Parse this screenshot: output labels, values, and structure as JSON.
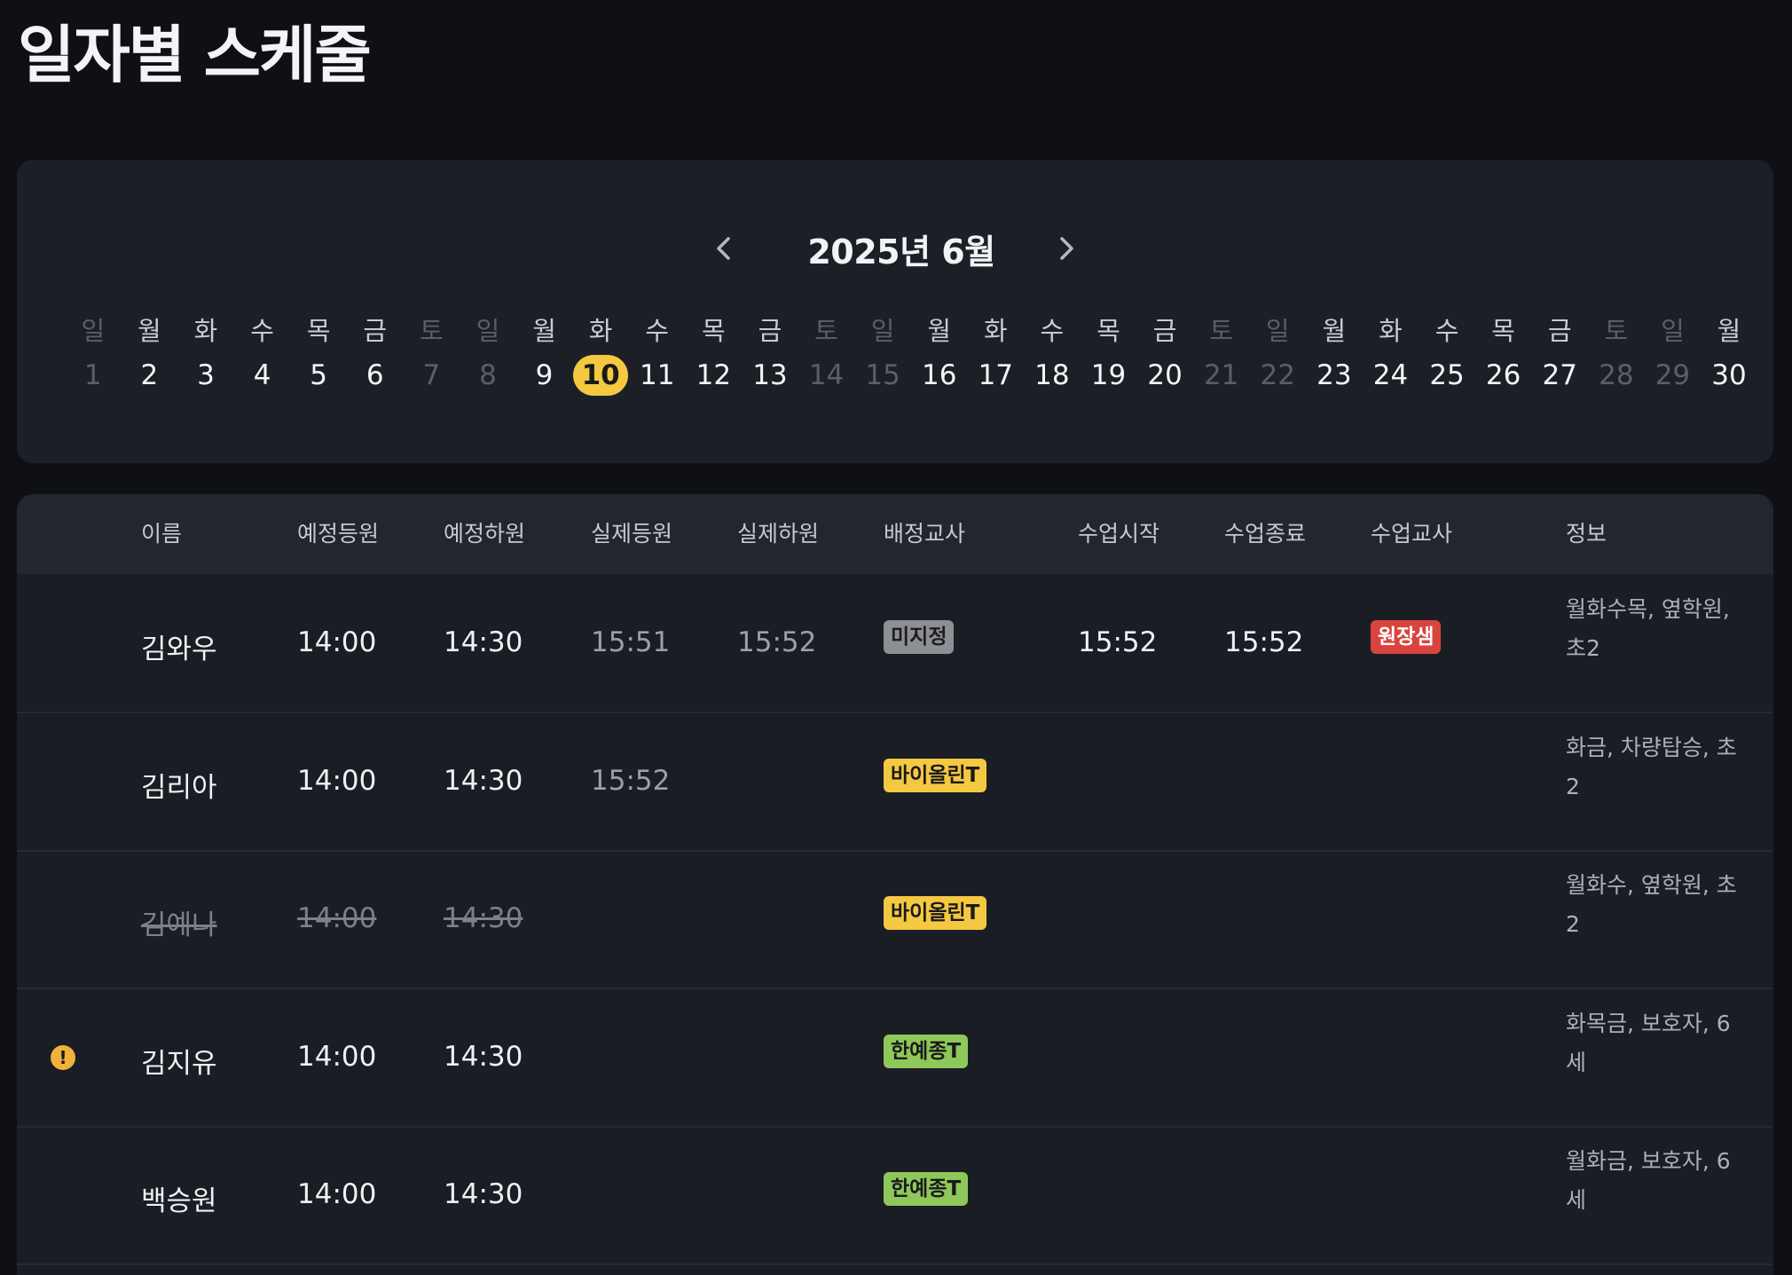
{
  "page": {
    "title": "일자별 스케줄"
  },
  "calendar": {
    "month_label": "2025년 6월",
    "selected_day": "10",
    "days": [
      {
        "dow": "일",
        "num": "1",
        "weekend": true
      },
      {
        "dow": "월",
        "num": "2",
        "weekend": false
      },
      {
        "dow": "화",
        "num": "3",
        "weekend": false
      },
      {
        "dow": "수",
        "num": "4",
        "weekend": false
      },
      {
        "dow": "목",
        "num": "5",
        "weekend": false
      },
      {
        "dow": "금",
        "num": "6",
        "weekend": false
      },
      {
        "dow": "토",
        "num": "7",
        "weekend": true
      },
      {
        "dow": "일",
        "num": "8",
        "weekend": true
      },
      {
        "dow": "월",
        "num": "9",
        "weekend": false
      },
      {
        "dow": "화",
        "num": "10",
        "weekend": false
      },
      {
        "dow": "수",
        "num": "11",
        "weekend": false
      },
      {
        "dow": "목",
        "num": "12",
        "weekend": false
      },
      {
        "dow": "금",
        "num": "13",
        "weekend": false
      },
      {
        "dow": "토",
        "num": "14",
        "weekend": true
      },
      {
        "dow": "일",
        "num": "15",
        "weekend": true
      },
      {
        "dow": "월",
        "num": "16",
        "weekend": false
      },
      {
        "dow": "화",
        "num": "17",
        "weekend": false
      },
      {
        "dow": "수",
        "num": "18",
        "weekend": false
      },
      {
        "dow": "목",
        "num": "19",
        "weekend": false
      },
      {
        "dow": "금",
        "num": "20",
        "weekend": false
      },
      {
        "dow": "토",
        "num": "21",
        "weekend": true
      },
      {
        "dow": "일",
        "num": "22",
        "weekend": true
      },
      {
        "dow": "월",
        "num": "23",
        "weekend": false
      },
      {
        "dow": "화",
        "num": "24",
        "weekend": false
      },
      {
        "dow": "수",
        "num": "25",
        "weekend": false
      },
      {
        "dow": "목",
        "num": "26",
        "weekend": false
      },
      {
        "dow": "금",
        "num": "27",
        "weekend": false
      },
      {
        "dow": "토",
        "num": "28",
        "weekend": true
      },
      {
        "dow": "일",
        "num": "29",
        "weekend": true
      },
      {
        "dow": "월",
        "num": "30",
        "weekend": false
      }
    ]
  },
  "table": {
    "headers": {
      "name": "이름",
      "planned_in": "예정등원",
      "planned_out": "예정하원",
      "actual_in": "실제등원",
      "actual_out": "실제하원",
      "assigned_teacher": "배정교사",
      "class_start": "수업시작",
      "class_end": "수업종료",
      "class_teacher": "수업교사",
      "info": "정보"
    },
    "rows": [
      {
        "warning": false,
        "cancelled": false,
        "name": "김와우",
        "planned_in": "14:00",
        "planned_out": "14:30",
        "actual_in": "15:51",
        "actual_out": "15:52",
        "assigned_teacher": "미지정",
        "assigned_color": "#8d8f94",
        "class_start": "15:52",
        "class_end": "15:52",
        "class_teacher": "원장샘",
        "class_teacher_color": "#d9453e",
        "info": "월화수목, 옆학원, 초2"
      },
      {
        "warning": false,
        "cancelled": false,
        "name": "김리아",
        "planned_in": "14:00",
        "planned_out": "14:30",
        "actual_in": "15:52",
        "actual_out": "",
        "assigned_teacher": "바이올린T",
        "assigned_color": "#f5c842",
        "class_start": "",
        "class_end": "",
        "class_teacher": "",
        "info": "화금, 차량탑승, 초2"
      },
      {
        "warning": false,
        "cancelled": true,
        "name": "김예나",
        "planned_in": "14:00",
        "planned_out": "14:30",
        "actual_in": "",
        "actual_out": "",
        "assigned_teacher": "바이올린T",
        "assigned_color": "#f5c842",
        "class_start": "",
        "class_end": "",
        "class_teacher": "",
        "info": "월화수, 옆학원, 초2"
      },
      {
        "warning": true,
        "cancelled": false,
        "name": "김지유",
        "planned_in": "14:00",
        "planned_out": "14:30",
        "actual_in": "",
        "actual_out": "",
        "assigned_teacher": "한예종T",
        "assigned_color": "#8fc85a",
        "class_start": "",
        "class_end": "",
        "class_teacher": "",
        "info": "화목금, 보호자, 6세"
      },
      {
        "warning": false,
        "cancelled": false,
        "name": "백승원",
        "planned_in": "14:00",
        "planned_out": "14:30",
        "actual_in": "",
        "actual_out": "",
        "assigned_teacher": "한예종T",
        "assigned_color": "#8fc85a",
        "class_start": "",
        "class_end": "",
        "class_teacher": "",
        "info": "월화금, 보호자, 6세"
      }
    ]
  },
  "icons": {
    "prev": "chevron-left-icon",
    "next": "chevron-right-icon",
    "warning": "warning-icon"
  },
  "colors": {
    "accent": "#f5c842",
    "background": "#0e1015",
    "card": "#1c1f26"
  }
}
